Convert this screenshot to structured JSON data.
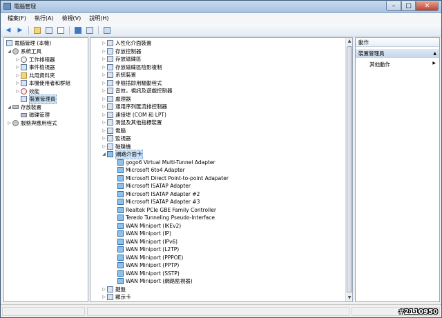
{
  "window": {
    "title": "電腦管理"
  },
  "menu": [
    "檔案(F)",
    "執行(A)",
    "檢視(V)",
    "說明(H)"
  ],
  "tree": {
    "root": "電腦管理 (本機)",
    "system_tools": "系統工具",
    "items": [
      "工作排程器",
      "事件檢視器",
      "共用資料夾",
      "本機使用者和群組",
      "效能",
      "裝置管理員"
    ],
    "storage": "存放裝置",
    "storage_items": [
      "磁碟管理"
    ],
    "services": "服務與應用程式"
  },
  "devices": {
    "categories_top": [
      "人性化介面裝置",
      "存放控制器",
      "存放磁碟區",
      "存放磁碟區陰影複制",
      "系統裝置",
      "非隨插即用驅動程式",
      "音效，視訊及遊戲控制器",
      "處理器",
      "通用序列匯流排控制器",
      "連接埠 (COM 和 LPT)",
      "滑鼠及其他指標裝置",
      "電腦",
      "監視器",
      "磁碟機"
    ],
    "network_category": "網路介面卡",
    "network_adapters": [
      "gogo6 Virtual Multi-Tunnel Adapter",
      "Microsoft 6to4 Adapter",
      "Microsoft Direct Point-to-point Adapater",
      "Microsoft ISATAP Adapter",
      "Microsoft ISATAP Adapter #2",
      "Microsoft ISATAP Adapter #3",
      "Realtek PCIe GBE Family Controller",
      "Teredo Tunneling Pseudo-Interface",
      "WAN Miniport (IKEv2)",
      "WAN Miniport (IP)",
      "WAN Miniport (IPv6)",
      "WAN Miniport (L2TP)",
      "WAN Miniport (PPPOE)",
      "WAN Miniport (PPTP)",
      "WAN Miniport (SSTP)",
      "WAN Miniport (網路監視器)"
    ],
    "categories_bottom": [
      "鍵盤",
      "顯示卡"
    ]
  },
  "actions": {
    "header": "動作",
    "section": "裝置管理員",
    "item": "其他動作"
  },
  "watermark": "#2110950"
}
